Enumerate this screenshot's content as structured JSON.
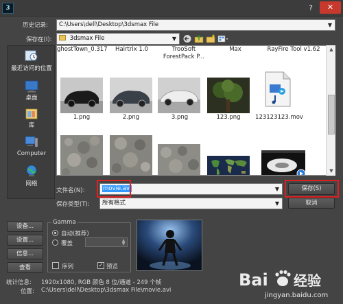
{
  "title_bar": {
    "app_icon_glyph": "3",
    "help": "?",
    "close": "✕"
  },
  "history": {
    "label": "历史记录:",
    "value": "C:\\Users\\dell\\Desktop\\3dsmax File"
  },
  "save_in": {
    "label": "保存在(I):",
    "value": "3dsmax File"
  },
  "places": [
    {
      "label": "最近访问的位置",
      "icon": "recent-places-icon"
    },
    {
      "label": "桌面",
      "icon": "desktop-icon"
    },
    {
      "label": "库",
      "icon": "library-icon"
    },
    {
      "label": "Computer",
      "icon": "computer-icon"
    },
    {
      "label": "网络",
      "icon": "network-icon"
    }
  ],
  "files_top_row": [
    "ghostTown_0.317",
    "Hairtrix 1.0",
    "TrooSoft ForestPack P...",
    "Max",
    "RayFire Tool v1.62"
  ],
  "files": [
    {
      "name": "1.png",
      "kind": "car-dark-thumbnail"
    },
    {
      "name": "2.png",
      "kind": "car-silver-thumbnail"
    },
    {
      "name": "3.png",
      "kind": "car-white-thumbnail"
    },
    {
      "name": "123.png",
      "kind": "tree-thumbnail"
    },
    {
      "name": "123123123.mov",
      "kind": "media-file-icon"
    }
  ],
  "files_bottom_row": [
    {
      "kind": "stone-texture-thumbnail"
    },
    {
      "kind": "stone-texture-thumbnail"
    },
    {
      "kind": "stone-texture-thumbnail"
    },
    {
      "kind": "world-map-thumbnail"
    },
    {
      "kind": "video-thumbnail"
    }
  ],
  "filename": {
    "label": "文件名(N):",
    "value": "movie.avi"
  },
  "filetype": {
    "label": "保存类型(T):",
    "value": "所有格式"
  },
  "buttons": {
    "save": "保存(S)",
    "cancel": "取消",
    "setup1": "设备...",
    "setup2": "设置...",
    "info": "信息...",
    "view": "查看"
  },
  "gamma": {
    "legend": "Gamma",
    "auto": "自动(推荐)",
    "override": "覆盖",
    "override_value": ""
  },
  "sequence": "序列",
  "preview_check": "预览",
  "stats": {
    "label": "统计信息:",
    "value": "1920x1080, RGB 颜色 8 位/通道 - 249 个帧"
  },
  "location": {
    "label": "位置:",
    "value": "C:\\Users\\dell\\Desktop\\3dsmax File\\movie.avi"
  },
  "watermark": {
    "brand": "Bai",
    "brand2": "经验",
    "url": "jingyan.baidu.com"
  },
  "colors": {
    "highlight_box": "#e02020",
    "selection": "#3399ff"
  }
}
